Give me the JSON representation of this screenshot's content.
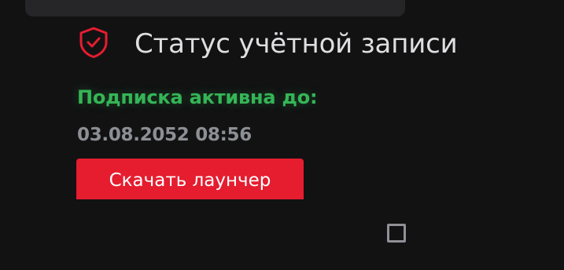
{
  "account_status": {
    "title": "Статус учётной записи",
    "title_icon": "shield-check-icon",
    "subscription_label": "Подписка активна до:",
    "subscription_expiry": "03.08.2052 08:56",
    "download_button_label": "Скачать лаунчер",
    "checkbox_checked": false
  },
  "colors": {
    "background": "#121213",
    "panel": "#262628",
    "accent_red": "#e51d2f",
    "active_green": "#35b556",
    "muted_text": "#8c8f94",
    "title_text": "#dfdfe1"
  }
}
